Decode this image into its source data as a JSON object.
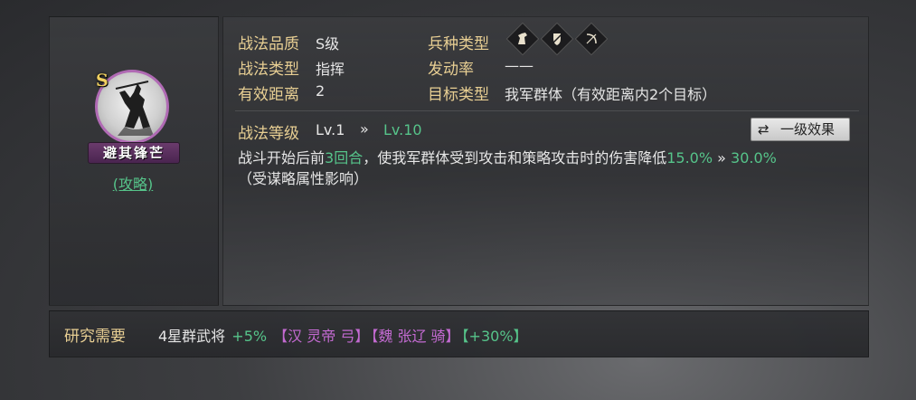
{
  "skill": {
    "grade": "S",
    "name": "避其锋芒",
    "strategy_link": "(攻略)"
  },
  "attributes": {
    "quality_label": "战法品质",
    "quality_value": "S级",
    "type_label": "战法类型",
    "type_value": "指挥",
    "range_label": "有效距离",
    "range_value": "2",
    "troop_label": "兵种类型",
    "troop_icons": [
      "cavalry-icon",
      "shield-icon",
      "bow-icon"
    ],
    "rate_label": "发动率",
    "rate_value": "——",
    "target_label": "目标类型",
    "target_value": "我军群体（有效距离内2个目标）"
  },
  "level": {
    "label": "战法等级",
    "current": "Lv.1",
    "arrow": "»",
    "max": "Lv.10",
    "button_icon": "⇄",
    "button_label": "一级效果"
  },
  "description": {
    "part1": "战斗开始后前",
    "rounds": "3回合",
    "part2": "，使我军群体受到攻击和策略攻击时的伤害降低",
    "from": "15.0%",
    "arrow": "»",
    "to": "30.0%",
    "note": "（受谋略属性影响）"
  },
  "research": {
    "label": "研究需要",
    "requirement": "4星群武将",
    "bonus1": "+5%",
    "item1": "【汉 灵帝 弓】",
    "item2": "【魏 张辽 骑】",
    "bonus2": "【+30%】"
  },
  "colors": {
    "label_gold": "#e8cf93",
    "accent_green": "#56c48a",
    "accent_purple": "#c36ad1",
    "grade_gold": "#f0d060"
  }
}
